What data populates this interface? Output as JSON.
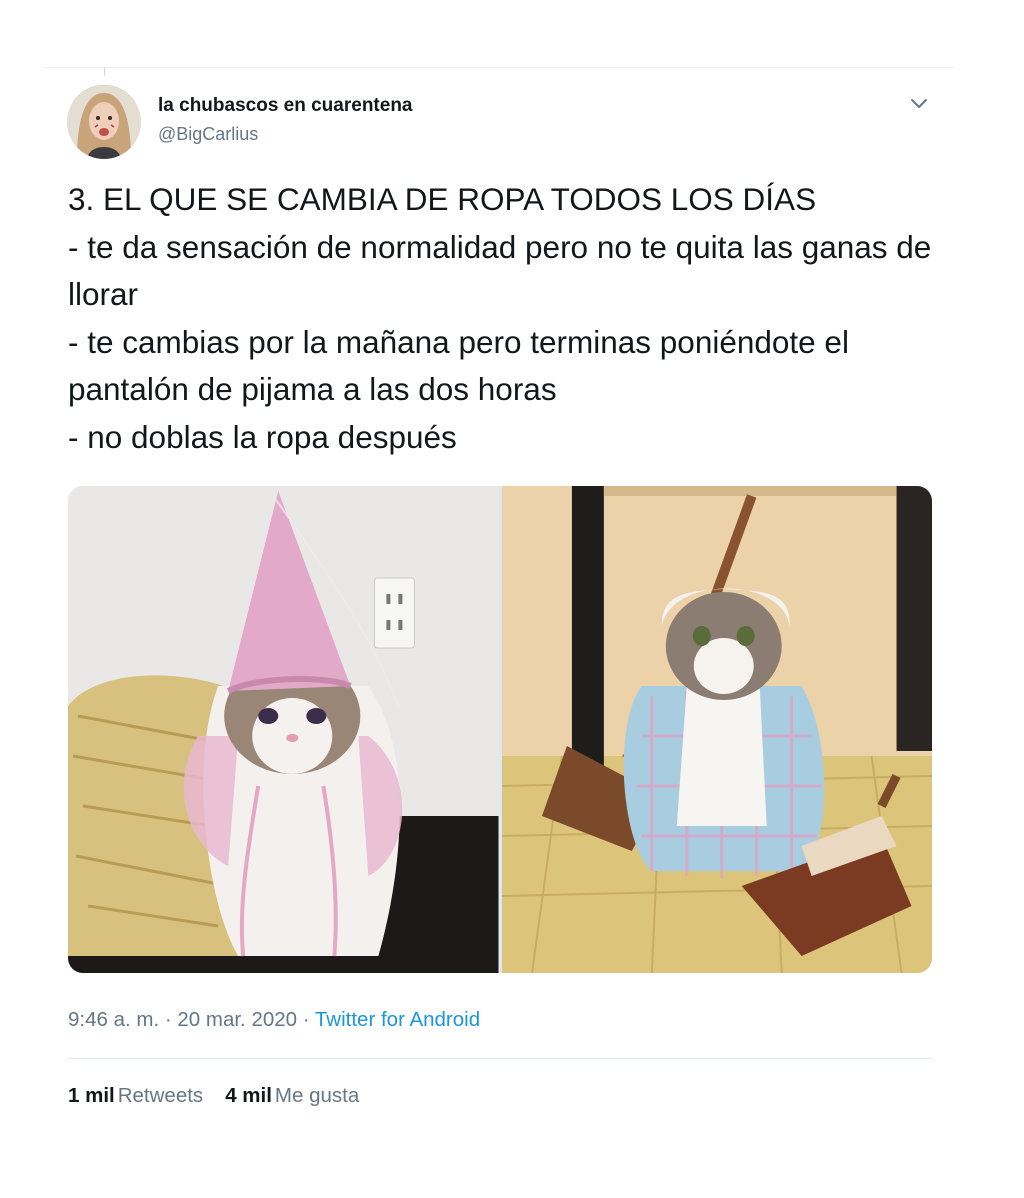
{
  "tweet": {
    "author": {
      "display_name": "la chubascos en cuarentena",
      "handle": "@BigCarlius"
    },
    "text": "3. EL QUE SE CAMBIA DE ROPA TODOS LOS DÍAS\n- te da sensación de normalidad pero no te quita las ganas de llorar\n- te cambias por la mañana pero terminas poniéndote el pantalón de pijama a las dos horas\n- no doblas la ropa después",
    "media": [
      {
        "kind": "photo",
        "depicts": "cat-fairy-costume"
      },
      {
        "kind": "photo",
        "depicts": "cat-maid-costume"
      }
    ],
    "timestamp": "9:46 a. m. · 20 mar. 2020",
    "separator": " · ",
    "source": "Twitter for Android",
    "stats": {
      "retweets_count": "1 mil",
      "retweets_label": "Retweets",
      "likes_count": "4 mil",
      "likes_label": "Me gusta"
    }
  },
  "icons": {
    "more": "chevron-down-icon"
  },
  "colors": {
    "text": "#14171a",
    "secondary": "#657786",
    "link": "#1b95e0",
    "divider": "#e6ecf0"
  }
}
